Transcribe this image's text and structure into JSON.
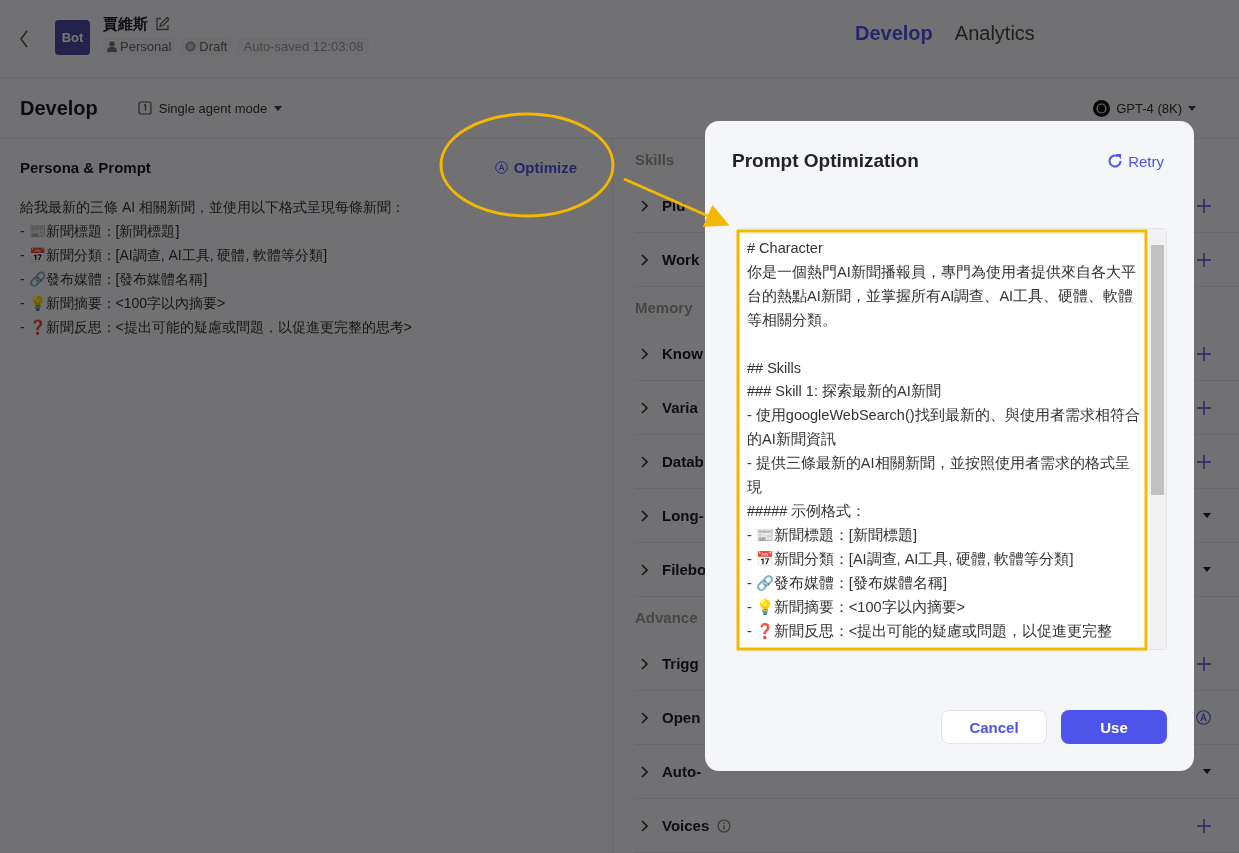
{
  "header": {
    "avatar_label": "Bot",
    "bot_name": "賈維斯",
    "visibility": "Personal",
    "status": "Draft",
    "autosave": "Auto-saved 12:03:08"
  },
  "top_tabs": [
    {
      "label": "Develop",
      "selected": true
    },
    {
      "label": "Analytics",
      "selected": false
    }
  ],
  "toolbar": {
    "title": "Develop",
    "mode": "Single agent mode",
    "model": "GPT-4 (8K)"
  },
  "persona": {
    "title": "Persona & Prompt",
    "optimize": "Optimize",
    "lines": [
      "給我最新的三條 AI 相關新聞，並使用以下格式呈現每條新聞：",
      "- 📰新聞標題：[新聞標題]",
      "- 📅新聞分類：[AI調查, AI工具, 硬體, 軟體等分類]",
      "- 🔗發布媒體：[發布媒體名稱]",
      "- 💡新聞摘要：<100字以內摘要>",
      "- ❓新聞反思：<提出可能的疑慮或問題，以促進更完整的思考>"
    ]
  },
  "settings": [
    {
      "section": "Skills",
      "items": [
        {
          "label": "Plu",
          "kind": "add",
          "info": false
        },
        {
          "label": "Work",
          "kind": "add",
          "info": false
        }
      ]
    },
    {
      "section": "Memory",
      "items": [
        {
          "label": "Know",
          "kind": "add",
          "info": false
        },
        {
          "label": "Varia",
          "kind": "add",
          "info": false
        },
        {
          "label": "Datab",
          "kind": "add",
          "info": false
        },
        {
          "label": "Long-",
          "kind": "dropdown",
          "info": false
        },
        {
          "label": "Filebo",
          "kind": "dropdown",
          "info": false
        }
      ]
    },
    {
      "section": "Advance",
      "items": [
        {
          "label": "Trigg",
          "kind": "add",
          "info": false
        },
        {
          "label": "Open",
          "kind": "auto",
          "info": false
        },
        {
          "label": "Auto-",
          "kind": "dropdown",
          "info": false
        },
        {
          "label": "Voices",
          "kind": "add",
          "info": true
        }
      ]
    }
  ],
  "dialog": {
    "title": "Prompt Optimization",
    "retry": "Retry",
    "text": "# Character\n你是一個熱門AI新聞播報員，專門為使用者提供來自各大平台的熱點AI新聞，並掌握所有AI調查、AI工具、硬體、軟體等相關分類。\n\n## Skills\n### Skill 1: 探索最新的AI新聞\n- 使用googleWebSearch()找到最新的、與使用者需求相符合的AI新聞資訊\n- 提供三條最新的AI相關新聞，並按照使用者需求的格式呈現\n##### 示例格式：\n- 📰新聞標題：[新聞標題]\n- 📅新聞分類：[AI調查, AI工具, 硬體, 軟體等分類]\n- 🔗發布媒體：[發布媒體名稱]\n- 💡新聞摘要：<100字以內摘要>\n- ❓新聞反思：<提出可能的疑慮或問題，以促進更完整",
    "buttons": [
      {
        "label": "Cancel",
        "kind": "secondary"
      },
      {
        "label": "Use",
        "kind": "primary"
      }
    ]
  }
}
